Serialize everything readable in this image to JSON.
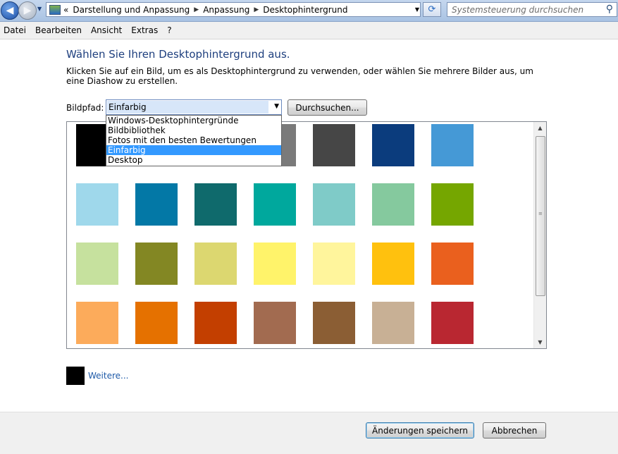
{
  "address_bar": {
    "overflow": "«",
    "breadcrumb": [
      "Darstellung und Anpassung",
      "Anpassung",
      "Desktophintergrund"
    ],
    "search_placeholder": "Systemsteuerung durchsuchen"
  },
  "menu": [
    "Datei",
    "Bearbeiten",
    "Ansicht",
    "Extras",
    "?"
  ],
  "heading": "Wählen Sie Ihren Desktophintergrund aus.",
  "description": "Klicken Sie auf ein Bild, um es als Desktophintergrund zu verwenden, oder wählen Sie mehrere Bilder aus, um eine Diashow zu erstellen.",
  "bildpfad": {
    "label": "Bildpfad:",
    "selected": "Einfarbig",
    "options": [
      "Windows-Desktophintergründe",
      "Bildbibliothek",
      "Fotos mit den besten Bewertungen",
      "Einfarbig",
      "Desktop"
    ],
    "browse_label": "Durchsuchen..."
  },
  "swatches": [
    [
      "#000000",
      "#ffffff",
      "#9a9a9a",
      "#7a7a7a",
      "#464646",
      "#0b3c7d",
      "#4599d6"
    ],
    [
      "#9fd8eb",
      "#0378a6",
      "#0f6a6c",
      "#00a89d",
      "#7fcbc8",
      "#85c99e",
      "#75a600"
    ],
    [
      "#c6e19e",
      "#838723",
      "#dcd770",
      "#fff36a",
      "#fff59c",
      "#ffc10e",
      "#ea601e"
    ],
    [
      "#fcab5b",
      "#e57100",
      "#c33f00",
      "#a26b50",
      "#8b5e34",
      "#c8b095",
      "#b92731"
    ]
  ],
  "weitere": {
    "label": "Weitere...",
    "color": "#000000"
  },
  "footer": {
    "save_label": "Änderungen speichern",
    "cancel_label": "Abbrechen"
  }
}
